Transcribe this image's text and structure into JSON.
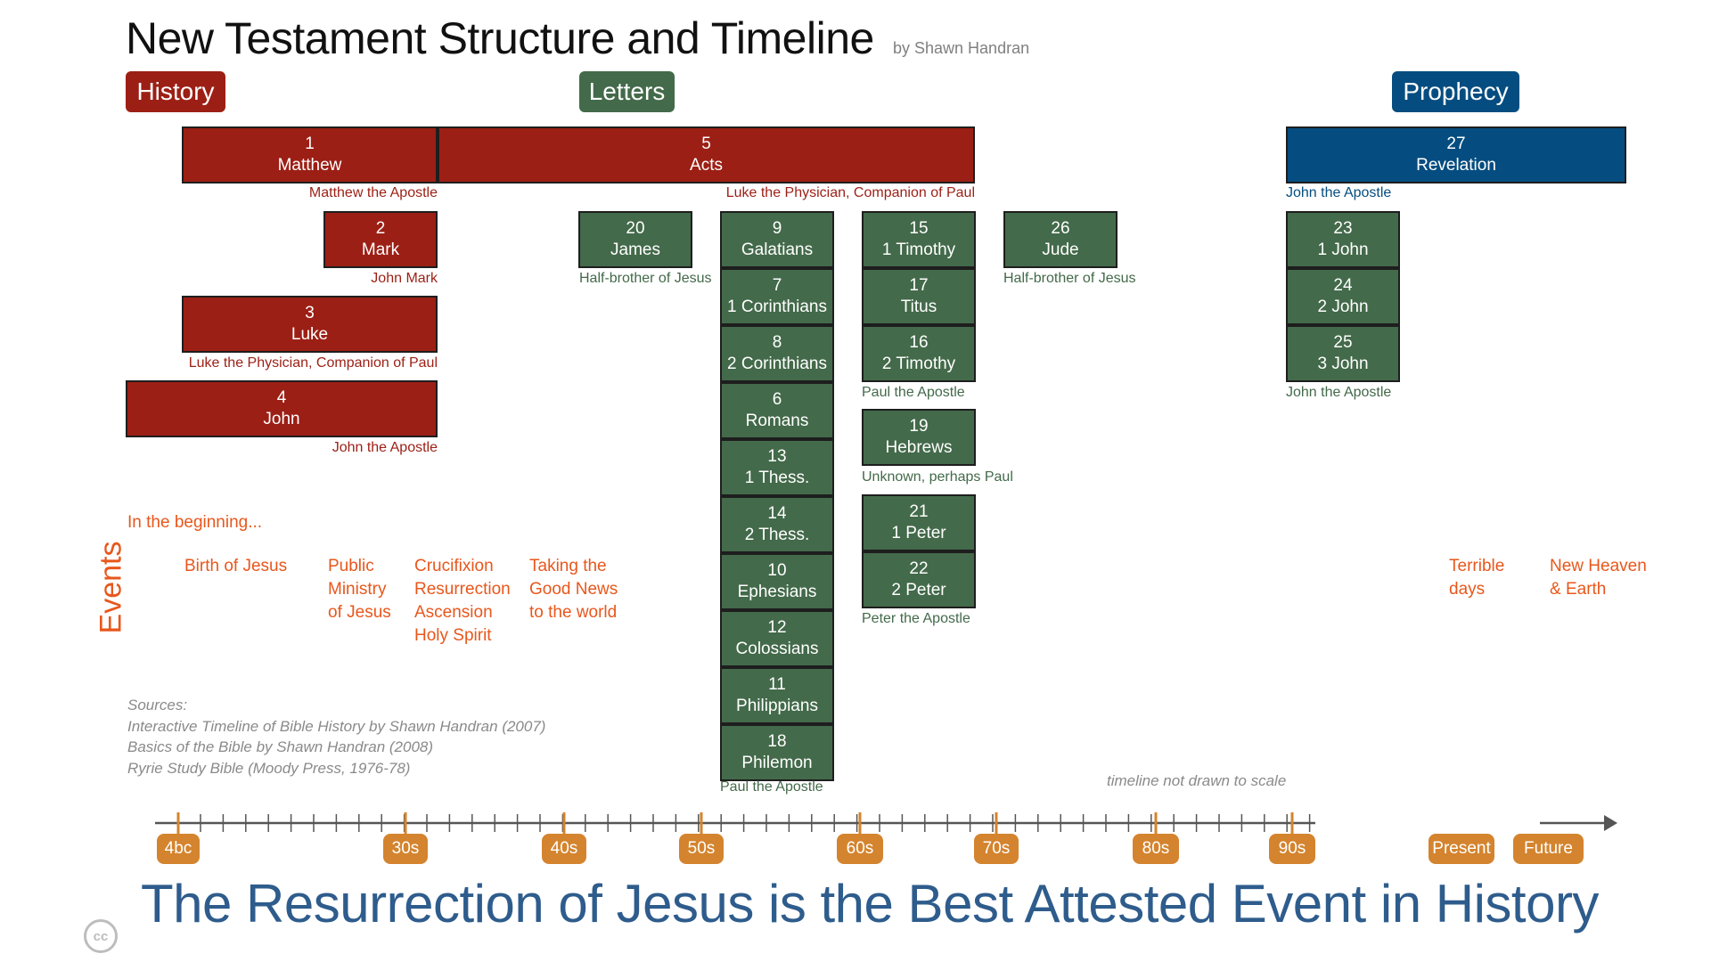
{
  "header": {
    "title": "New Testament Structure and Timeline",
    "byline": "by Shawn Handran"
  },
  "categories": {
    "history": "History",
    "letters": "Letters",
    "prophecy": "Prophecy"
  },
  "colors": {
    "history": "#9c1f15",
    "letters": "#436a4a",
    "prophecy": "#054d80",
    "events": "#e8571c",
    "timeline_marker": "#d4842e",
    "tagline": "#2e5c8c"
  },
  "books": [
    {
      "num": "1",
      "name": "Matthew",
      "group": "history"
    },
    {
      "num": "5",
      "name": "Acts",
      "group": "history"
    },
    {
      "num": "2",
      "name": "Mark",
      "group": "history"
    },
    {
      "num": "3",
      "name": "Luke",
      "group": "history"
    },
    {
      "num": "4",
      "name": "John",
      "group": "history"
    },
    {
      "num": "20",
      "name": "James",
      "group": "letter"
    },
    {
      "num": "9",
      "name": "Galatians",
      "group": "letter"
    },
    {
      "num": "7",
      "name": "1 Corinthians",
      "group": "letter"
    },
    {
      "num": "8",
      "name": "2 Corinthians",
      "group": "letter"
    },
    {
      "num": "6",
      "name": "Romans",
      "group": "letter"
    },
    {
      "num": "13",
      "name": "1 Thess.",
      "group": "letter"
    },
    {
      "num": "14",
      "name": "2 Thess.",
      "group": "letter"
    },
    {
      "num": "10",
      "name": "Ephesians",
      "group": "letter"
    },
    {
      "num": "12",
      "name": "Colossians",
      "group": "letter"
    },
    {
      "num": "11",
      "name": "Philippians",
      "group": "letter"
    },
    {
      "num": "18",
      "name": "Philemon",
      "group": "letter"
    },
    {
      "num": "15",
      "name": "1 Timothy",
      "group": "letter"
    },
    {
      "num": "17",
      "name": "Titus",
      "group": "letter"
    },
    {
      "num": "16",
      "name": "2 Timothy",
      "group": "letter"
    },
    {
      "num": "19",
      "name": "Hebrews",
      "group": "letter"
    },
    {
      "num": "21",
      "name": "1 Peter",
      "group": "letter"
    },
    {
      "num": "22",
      "name": "2 Peter",
      "group": "letter"
    },
    {
      "num": "26",
      "name": "Jude",
      "group": "letter"
    },
    {
      "num": "23",
      "name": "1 John",
      "group": "letter"
    },
    {
      "num": "24",
      "name": "2 John",
      "group": "letter"
    },
    {
      "num": "25",
      "name": "3 John",
      "group": "letter"
    },
    {
      "num": "27",
      "name": "Revelation",
      "group": "prophecy"
    }
  ],
  "authors": {
    "matthew": "Matthew the Apostle",
    "acts": "Luke the Physician, Companion of Paul",
    "mark": "John Mark",
    "luke": "Luke the Physician, Companion of Paul",
    "john": "John the Apostle",
    "james": "Half-brother of Jesus",
    "paul_main": "Paul the Apostle",
    "paul_pastoral": "Paul the Apostle",
    "hebrews": "Unknown, perhaps Paul",
    "peter": "Peter the Apostle",
    "jude": "Half-brother of Jesus",
    "john_letters": "John the Apostle",
    "revelation": "John the Apostle"
  },
  "events": {
    "label": "Events",
    "beginning": "In the beginning...",
    "birth": "Birth of Jesus",
    "ministry": "Public\nMinistry\nof Jesus",
    "passion": "Crucifixion\nResurrection\nAscension\nHoly Spirit",
    "spread": "Taking the\nGood News\nto the world",
    "terrible": "Terrible\ndays",
    "new_heaven": "New Heaven\n& Earth"
  },
  "sources": {
    "heading": "Sources:",
    "items": [
      "Interactive Timeline of Bible History by Shawn Handran (2007)",
      "Basics of the Bible by Shawn Handran (2008)",
      "Ryrie Study Bible (Moody Press, 1976-78)"
    ]
  },
  "scale_note": "timeline not drawn to scale",
  "timeline": {
    "labels": [
      "4bc",
      "30s",
      "40s",
      "50s",
      "60s",
      "70s",
      "80s",
      "90s",
      "Present",
      "Future"
    ]
  },
  "tagline": "The Resurrection of Jesus is the Best Attested Event in History",
  "license": "cc"
}
